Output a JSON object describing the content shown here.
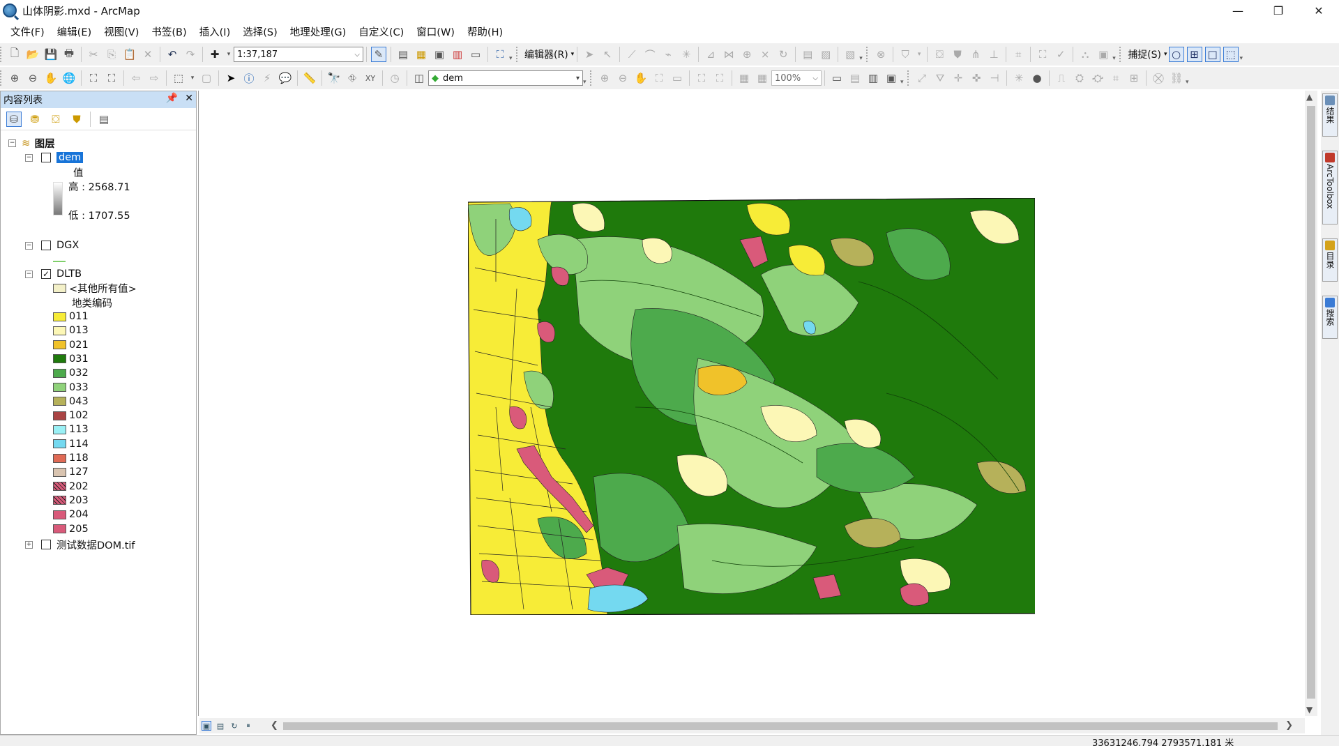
{
  "window": {
    "title": "山体阴影.mxd - ArcMap",
    "minimize": "—",
    "restore": "❐",
    "close": "✕"
  },
  "menu": [
    "文件(F)",
    "编辑(E)",
    "视图(V)",
    "书签(B)",
    "插入(I)",
    "选择(S)",
    "地理处理(G)",
    "自定义(C)",
    "窗口(W)",
    "帮助(H)"
  ],
  "toolbar": {
    "scale": "1:37,187",
    "editor_label": "编辑器(R)",
    "snapping_label": "捕捉(S)",
    "layer_combo": "dem",
    "zoom_combo": "100%"
  },
  "toc": {
    "title": "内容列表",
    "root_label": "图层",
    "layers": {
      "dem": {
        "name": "dem",
        "field_label": "值",
        "high": "高 : 2568.71",
        "low": "低 : 1707.55",
        "checked": false
      },
      "dgx": {
        "name": "DGX",
        "checked": false
      },
      "dltb": {
        "name": "DLTB",
        "checked": true,
        "other_values": "<其他所有值>",
        "field_label": "地类编码",
        "classes": [
          {
            "code": "011",
            "color": "#f7ec37",
            "hatch": false
          },
          {
            "code": "013",
            "color": "#fcf7b6",
            "hatch": false
          },
          {
            "code": "021",
            "color": "#f0c22a",
            "hatch": false
          },
          {
            "code": "031",
            "color": "#1f7a0c",
            "hatch": false
          },
          {
            "code": "032",
            "color": "#4daa4c",
            "hatch": false
          },
          {
            "code": "033",
            "color": "#8fd27a",
            "hatch": false
          },
          {
            "code": "043",
            "color": "#b6b15a",
            "hatch": false
          },
          {
            "code": "102",
            "color": "#a94343",
            "hatch": false
          },
          {
            "code": "113",
            "color": "#9af0f5",
            "hatch": false
          },
          {
            "code": "114",
            "color": "#74d9f0",
            "hatch": false
          },
          {
            "code": "118",
            "color": "#e06a55",
            "hatch": false
          },
          {
            "code": "127",
            "color": "#d9c4b0",
            "hatch": false
          },
          {
            "code": "202",
            "color": "#d95a7a",
            "hatch": true
          },
          {
            "code": "203",
            "color": "#d95a7a",
            "hatch": true
          },
          {
            "code": "204",
            "color": "#d95a7a",
            "hatch": false
          },
          {
            "code": "205",
            "color": "#d95a7a",
            "hatch": false
          }
        ]
      },
      "dom": {
        "name": "测试数据DOM.tif",
        "checked": false
      }
    }
  },
  "right_dock": [
    "结果",
    "ArcToolbox",
    "目录",
    "搜索"
  ],
  "status": {
    "coordinates": "33631246.794  2793571.181 米"
  },
  "colors": {
    "selection": "#1874d8",
    "toc_header": "#c9dff5",
    "forest_dark": "#1f7a0c",
    "forest_mid": "#4daa4c",
    "grass": "#8fd27a",
    "farmland": "#f7ec37",
    "pale": "#fcf7b6",
    "orange": "#f0c22a",
    "water": "#74d9f0",
    "urban": "#d95a7a"
  }
}
